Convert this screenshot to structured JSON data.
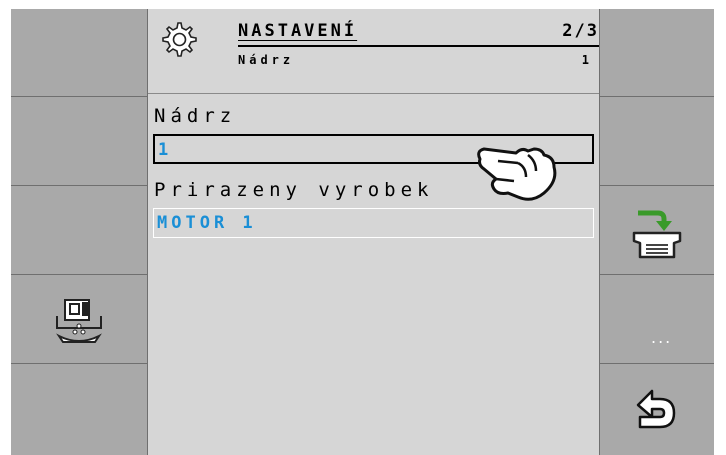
{
  "header": {
    "title": "NASTAVENÍ",
    "page": "2/3",
    "subtitle": "Nádrz",
    "subvalue": "1",
    "icon": "gear-icon"
  },
  "fields": [
    {
      "label": "Nádrz",
      "value": "1",
      "active": true
    },
    {
      "label": "Prirazeny vyrobek",
      "value": "MOTOR 1",
      "active": false
    }
  ],
  "softkeys": {
    "left": [
      "",
      "",
      "",
      "hopper-dosing-icon",
      ""
    ],
    "right": [
      "",
      "",
      "tank-transfer-icon",
      "more-icon",
      "back-icon"
    ],
    "more_label": "..."
  },
  "colors": {
    "frame": "#a9a9a9",
    "panel": "#d6d6d6",
    "value_text": "#1a8fd6",
    "accent_green": "#3a9a2a"
  }
}
